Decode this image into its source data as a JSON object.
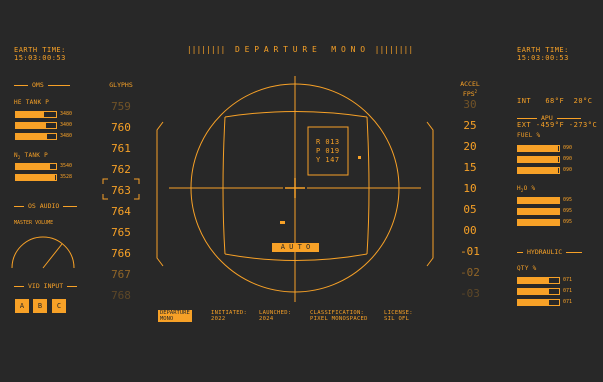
{
  "header": {
    "left_label": "EARTH TIME:",
    "left_time": "15:03:00:53",
    "title": "||||||||  D E P A R T U R E   M O N O  ||||||||",
    "right_label": "EARTH TIME:",
    "right_time": "15:03:00:53"
  },
  "oms": {
    "title": "OMS",
    "he_tank": {
      "label": "HE TANK P",
      "bars": [
        {
          "value": "3480",
          "fill": 0.68
        },
        {
          "value": "3400",
          "fill": 0.72
        },
        {
          "value": "3480",
          "fill": 0.74
        }
      ]
    },
    "n2_tank": {
      "label": "N",
      "sub": "2",
      "label_rest": " TANK P",
      "bars": [
        {
          "value": "3540",
          "fill": 0.82
        },
        {
          "value": "3528",
          "fill": 0.95
        }
      ]
    }
  },
  "os_audio": {
    "title": "OS AUDIO",
    "label": "MASTER VOLUME"
  },
  "vid_input": {
    "title": "VID INPUT",
    "buttons": [
      "A",
      "B",
      "C"
    ]
  },
  "glyphs": {
    "title": "GLYPHS",
    "values": [
      "759",
      "760",
      "761",
      "762",
      "763",
      "764",
      "765",
      "766",
      "767",
      "768"
    ],
    "selected": "763"
  },
  "accel": {
    "title": "ACCEL",
    "unit": "FPS",
    "unit_sup": "2",
    "values": [
      "30",
      "25",
      "20",
      "15",
      "10",
      "05",
      "00",
      "-01",
      "-02",
      "-03"
    ]
  },
  "hud": {
    "readout": [
      "R 013",
      "P 019",
      "Y 147"
    ],
    "mode": "A U T O"
  },
  "env": {
    "int_label": "INT",
    "int_f": "68°F",
    "int_c": "20°C",
    "ext_label": "EXT",
    "ext_f": "-459°F",
    "ext_c": "-273°C"
  },
  "apu": {
    "title": "APU",
    "fuel": {
      "label": "FUEL %",
      "bars": [
        {
          "value": "090",
          "fill": 0.95
        },
        {
          "value": "090",
          "fill": 0.95
        },
        {
          "value": "090",
          "fill": 0.95
        }
      ]
    },
    "h2o": {
      "label": "H",
      "sub": "2",
      "label_rest": "O %",
      "bars": [
        {
          "value": "095",
          "fill": 0.97
        },
        {
          "value": "095",
          "fill": 0.97
        },
        {
          "value": "095",
          "fill": 0.97
        }
      ]
    }
  },
  "hydraulic": {
    "title": "HYDRAULIC",
    "qty": {
      "label": "QTY %",
      "bars": [
        {
          "value": "071",
          "fill": 0.72
        },
        {
          "value": "071",
          "fill": 0.72
        },
        {
          "value": "071",
          "fill": 0.72
        }
      ]
    }
  },
  "footer": {
    "badge_line1": "DEPARTURE",
    "badge_line2": "MONO",
    "items": [
      {
        "label": "INITIATED:",
        "value": "2022"
      },
      {
        "label": "LAUNCHED:",
        "value": "2024"
      },
      {
        "label": "CLASSIFICATION:",
        "value": "PIXEL MONOSPACED"
      },
      {
        "label": "LICENSE:",
        "value": "SIL OFL"
      }
    ]
  },
  "colors": {
    "accent": "#f7a127",
    "background": "#282828"
  }
}
